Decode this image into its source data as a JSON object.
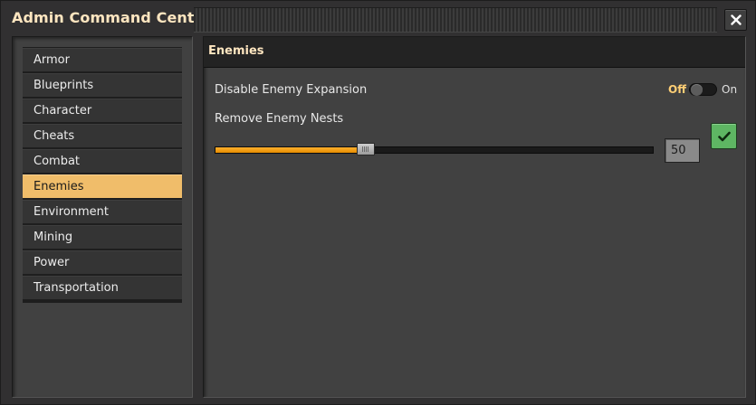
{
  "window": {
    "title": "Admin Command Center",
    "close_icon": "close-icon"
  },
  "sidebar": {
    "items": [
      {
        "label": "Armor",
        "selected": false
      },
      {
        "label": "Blueprints",
        "selected": false
      },
      {
        "label": "Character",
        "selected": false
      },
      {
        "label": "Cheats",
        "selected": false
      },
      {
        "label": "Combat",
        "selected": false
      },
      {
        "label": "Enemies",
        "selected": true
      },
      {
        "label": "Environment",
        "selected": false
      },
      {
        "label": "Mining",
        "selected": false
      },
      {
        "label": "Power",
        "selected": false
      },
      {
        "label": "Transportation",
        "selected": false
      }
    ]
  },
  "main": {
    "title": "Enemies",
    "expansion": {
      "label": "Disable Enemy Expansion",
      "off_label": "Off",
      "on_label": "On",
      "state": "off"
    },
    "nests": {
      "label": "Remove Enemy Nests",
      "value": "50",
      "fill_fraction": 0.33,
      "confirm_icon": "checkmark-icon"
    }
  },
  "colors": {
    "accent_selected": "#f0bd6a",
    "title_text": "#ffe6c0",
    "slider_fill": "#ffb02e",
    "confirm_green": "#5eb663"
  }
}
